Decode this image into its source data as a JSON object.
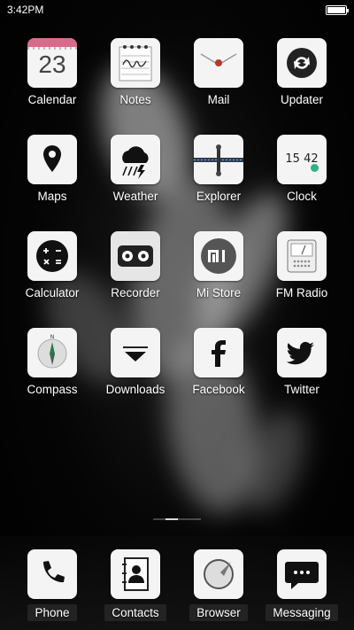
{
  "status_bar": {
    "time": "3:42PM",
    "battery_level": 1.0
  },
  "calendar_day": "23",
  "clock_time": "15 42",
  "colors": {
    "calendar_band": "#d96b8a",
    "mail_seal": "#b13a2a",
    "clock_dot": "#2fb28a"
  },
  "apps": [
    {
      "label": "Calendar",
      "icon": "calendar-icon"
    },
    {
      "label": "Notes",
      "icon": "notes-icon"
    },
    {
      "label": "Mail",
      "icon": "mail-icon"
    },
    {
      "label": "Updater",
      "icon": "updater-icon"
    },
    {
      "label": "Maps",
      "icon": "map-pin-icon"
    },
    {
      "label": "Weather",
      "icon": "weather-icon"
    },
    {
      "label": "Explorer",
      "icon": "explorer-icon"
    },
    {
      "label": "Clock",
      "icon": "clock-icon"
    },
    {
      "label": "Calculator",
      "icon": "calculator-icon"
    },
    {
      "label": "Recorder",
      "icon": "recorder-icon"
    },
    {
      "label": "Mi Store",
      "icon": "mi-store-icon"
    },
    {
      "label": "FM Radio",
      "icon": "radio-icon"
    },
    {
      "label": "Compass",
      "icon": "compass-icon"
    },
    {
      "label": "Downloads",
      "icon": "download-icon"
    },
    {
      "label": "Facebook",
      "icon": "facebook-icon"
    },
    {
      "label": "Twitter",
      "icon": "twitter-icon"
    }
  ],
  "dock": [
    {
      "label": "Phone",
      "icon": "phone-icon"
    },
    {
      "label": "Contacts",
      "icon": "contacts-icon"
    },
    {
      "label": "Browser",
      "icon": "browser-icon"
    },
    {
      "label": "Messaging",
      "icon": "messaging-icon"
    }
  ]
}
